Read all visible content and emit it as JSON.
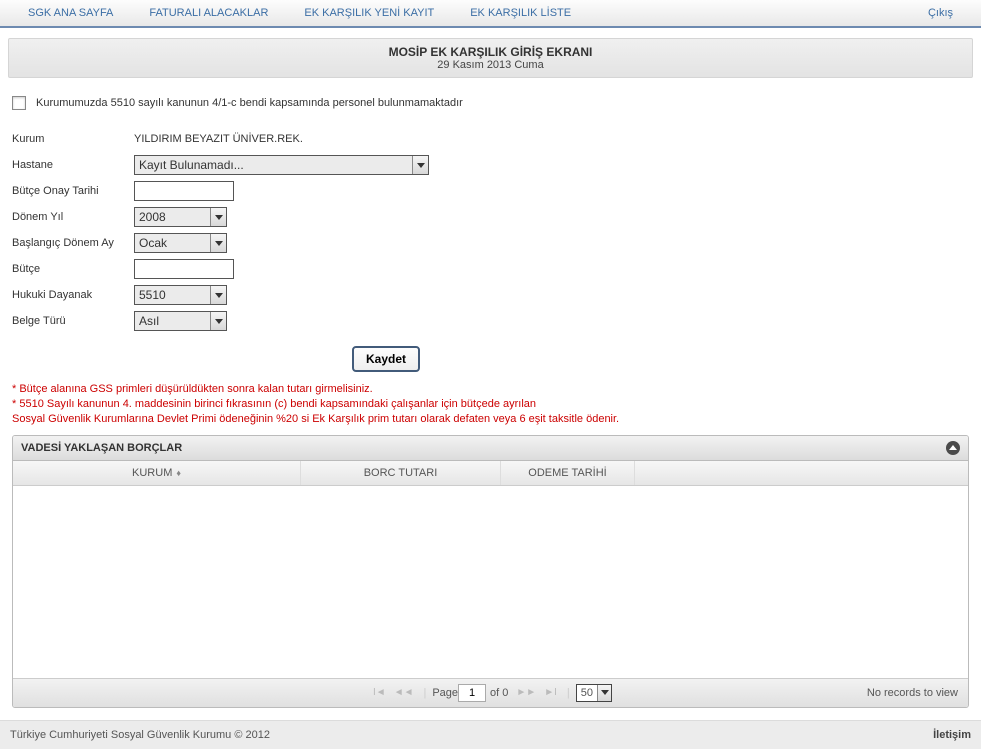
{
  "nav": {
    "items": [
      "SGK ANA SAYFA",
      "FATURALI ALACAKLAR",
      "EK KARŞILIK YENİ KAYIT",
      "EK KARŞILIK LİSTE"
    ],
    "logout": "Çıkış"
  },
  "header": {
    "title": "MOSİP EK KARŞILIK GİRİŞ EKRANI",
    "date": "29 Kasım 2013 Cuma"
  },
  "checkbox_label": "Kurumumuzda 5510 sayılı kanunun 4/1-c bendi kapsamında personel bulunmamaktadır",
  "form": {
    "kurum_label": "Kurum",
    "kurum_value": "YILDIRIM BEYAZIT ÜNİVER.REK.",
    "hastane_label": "Hastane",
    "hastane_value": "Kayıt Bulunamadı...",
    "butce_onay_label": "Bütçe Onay Tarihi",
    "butce_onay_value": "",
    "donem_yil_label": "Dönem Yıl",
    "donem_yil_value": "2008",
    "baslangic_label": "Başlangıç Dönem Ay",
    "baslangic_value": "Ocak",
    "butce_label": "Bütçe",
    "butce_value": "",
    "hukuki_label": "Hukuki Dayanak",
    "hukuki_value": "5510",
    "belge_label": "Belge Türü",
    "belge_value": "Asıl",
    "save_label": "Kaydet"
  },
  "notes": {
    "line1": "* Bütçe alanına GSS primleri düşürüldükten sonra kalan tutarı girmelisiniz.",
    "line2": "* 5510 Sayılı kanunun 4. maddesinin birinci fıkrasının (c) bendi kapsamındaki çalışanlar için bütçede ayrılan",
    "line3": "Sosyal Güvenlik Kurumlarına Devlet Primi ödeneğinin %20 si Ek Karşılık prim tutarı olarak defaten veya 6 eşit taksitle ödenir."
  },
  "grid": {
    "title": "VADESİ YAKLAŞAN BORÇLAR",
    "columns": {
      "kurum": "KURUM",
      "borc": "BORC TUTARI",
      "odeme": "ODEME TARİHİ"
    },
    "pager": {
      "page_label": "Page",
      "page_value": "1",
      "of_label": "of 0",
      "page_size": "50",
      "status": "No records to view"
    }
  },
  "footer": {
    "copyright": "Türkiye Cumhuriyeti Sosyal Güvenlik Kurumu © 2012",
    "contact": "İletişim"
  }
}
